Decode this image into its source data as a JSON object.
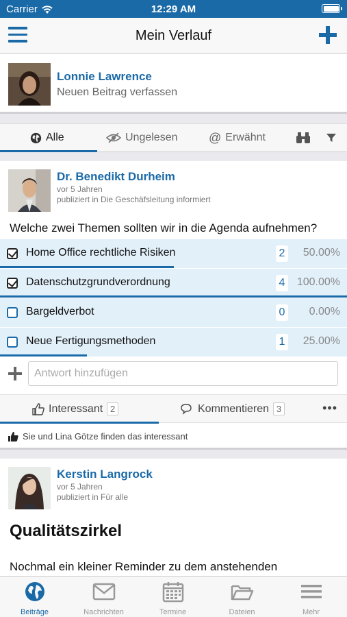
{
  "status_bar": {
    "carrier": "Carrier",
    "time": "12:29 AM"
  },
  "nav": {
    "title": "Mein Verlauf",
    "menu_icon": "hamburger-icon",
    "add_icon": "plus-icon"
  },
  "composer": {
    "user_name": "Lonnie Lawrence",
    "prompt": "Neuen Beitrag verfassen"
  },
  "filter_tabs": [
    {
      "label": "Alle",
      "icon": "globe-icon",
      "active": true
    },
    {
      "label": "Ungelesen",
      "icon": "eye-slash-icon"
    },
    {
      "label": "Erwähnt",
      "icon": "at-icon"
    }
  ],
  "filter_icons": {
    "search": "binoculars-icon",
    "filter": "funnel-icon"
  },
  "post1": {
    "author": "Dr. Benedikt Durheim",
    "time": "vor 5 Jahren",
    "published_in": "publiziert in Die Geschäfsleitung informiert",
    "question": "Welche zwei Themen sollten wir in die Agenda aufnehmen?",
    "options": [
      {
        "label": "Home Office rechtliche Risiken",
        "count": "2",
        "percent": "50.00%",
        "share": 0.5,
        "checked": true
      },
      {
        "label": "Datenschutzgrundverordnung",
        "count": "4",
        "percent": "100.00%",
        "share": 1.0,
        "checked": true
      },
      {
        "label": "Bargeldverbot",
        "count": "0",
        "percent": "0.00%",
        "share": 0.0,
        "checked": false
      },
      {
        "label": "Neue Fertigungsmethoden",
        "count": "1",
        "percent": "25.00%",
        "share": 0.25,
        "checked": false
      }
    ],
    "answer_placeholder": "Antwort hinzufügen",
    "actions": {
      "like_label": "Interessant",
      "like_count": "2",
      "comment_label": "Kommentieren",
      "comment_count": "3",
      "more": "•••"
    },
    "likers": "Sie und Lina Götze finden das interessant"
  },
  "post2": {
    "author": "Kerstin Langrock",
    "time": "vor 5 Jahren",
    "published_in": "publiziert in Für alle",
    "title": "Qualitätszirkel",
    "body": "Nochmal ein kleiner Reminder zu dem anstehenden"
  },
  "tab_bar": [
    {
      "label": "Beiträge",
      "icon": "globe-icon",
      "active": true
    },
    {
      "label": "Nachrichten",
      "icon": "envelope-icon"
    },
    {
      "label": "Termine",
      "icon": "calendar-icon"
    },
    {
      "label": "Dateien",
      "icon": "folder-open-icon"
    },
    {
      "label": "Mehr",
      "icon": "hamburger-icon"
    }
  ],
  "colors": {
    "accent": "#1a6aa8",
    "poll_bg": "#e2f0fa",
    "page_bg": "#e9e9ee"
  }
}
